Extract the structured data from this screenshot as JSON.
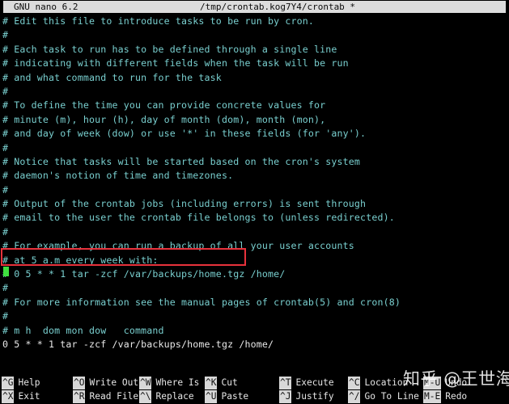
{
  "titlebar": {
    "version": "GNU nano 6.2",
    "path": "/tmp/crontab.kog7Y4/crontab *"
  },
  "editor": {
    "lines": [
      "# Edit this file to introduce tasks to be run by cron.",
      "#",
      "# Each task to run has to be defined through a single line",
      "# indicating with different fields when the task will be run",
      "# and what command to run for the task",
      "#",
      "# To define the time you can provide concrete values for",
      "# minute (m), hour (h), day of month (dom), month (mon),",
      "# and day of week (dow) or use '*' in these fields (for 'any').",
      "#",
      "# Notice that tasks will be started based on the cron's system",
      "# daemon's notion of time and timezones.",
      "#",
      "# Output of the crontab jobs (including errors) is sent through",
      "# email to the user the crontab file belongs to (unless redirected).",
      "#",
      "# For example, you can run a backup of all your user accounts",
      "# at 5 a.m every week with:",
      "# 0 5 * * 1 tar -zcf /var/backups/home.tgz /home/",
      "#",
      "# For more information see the manual pages of crontab(5) and cron(8)",
      "#",
      "# m h  dom mon dow   command"
    ],
    "command_line": "0 5 * * 1 tar -zcf /var/backups/home.tgz /home/"
  },
  "shortcuts": {
    "row1": [
      {
        "key": "^G",
        "label": "Help"
      },
      {
        "key": "^O",
        "label": "Write Out"
      },
      {
        "key": "^W",
        "label": "Where Is"
      },
      {
        "key": "^K",
        "label": "Cut"
      },
      {
        "key": "^T",
        "label": "Execute"
      },
      {
        "key": "^C",
        "label": "Location"
      },
      {
        "key": "M-U",
        "label": "Undo"
      }
    ],
    "row2": [
      {
        "key": "^X",
        "label": "Exit"
      },
      {
        "key": "^R",
        "label": "Read File"
      },
      {
        "key": "^\\",
        "label": "Replace"
      },
      {
        "key": "^U",
        "label": "Paste"
      },
      {
        "key": "^J",
        "label": "Justify"
      },
      {
        "key": "^/",
        "label": "Go To Line"
      },
      {
        "key": "M-E",
        "label": "Redo"
      }
    ]
  },
  "watermark": {
    "text": "知乎 @王世海"
  },
  "colors": {
    "background": "#000000",
    "comment_text": "#79cfcf",
    "command_text": "#e8e8e8",
    "titlebar_bg": "#dcdcdc",
    "annotation_box": "#e8323c",
    "cursor": "#3fe03f"
  }
}
